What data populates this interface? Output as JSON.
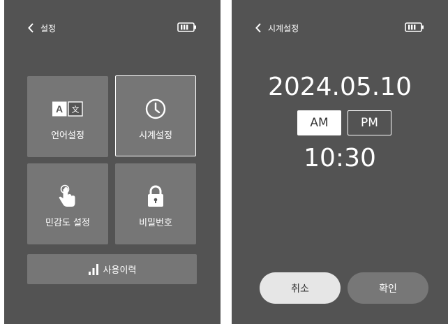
{
  "settings_screen": {
    "back_label": "설정",
    "tiles": [
      {
        "label": "언어설정",
        "icon": "language-icon",
        "selected": false
      },
      {
        "label": "시계설정",
        "icon": "clock-icon",
        "selected": true
      },
      {
        "label": "민감도 설정",
        "icon": "touch-icon",
        "selected": false
      },
      {
        "label": "비밀번호",
        "icon": "lock-icon",
        "selected": false
      }
    ],
    "history_label": "사용이력"
  },
  "clock_screen": {
    "back_label": "시계설정",
    "date": "2024.05.10",
    "am_label": "AM",
    "pm_label": "PM",
    "selected_period": "AM",
    "time": "10:30",
    "cancel_label": "취소",
    "confirm_label": "확인"
  },
  "colors": {
    "screen_bg": "#535353",
    "tile_bg": "#767676",
    "accent": "#ffffff"
  }
}
